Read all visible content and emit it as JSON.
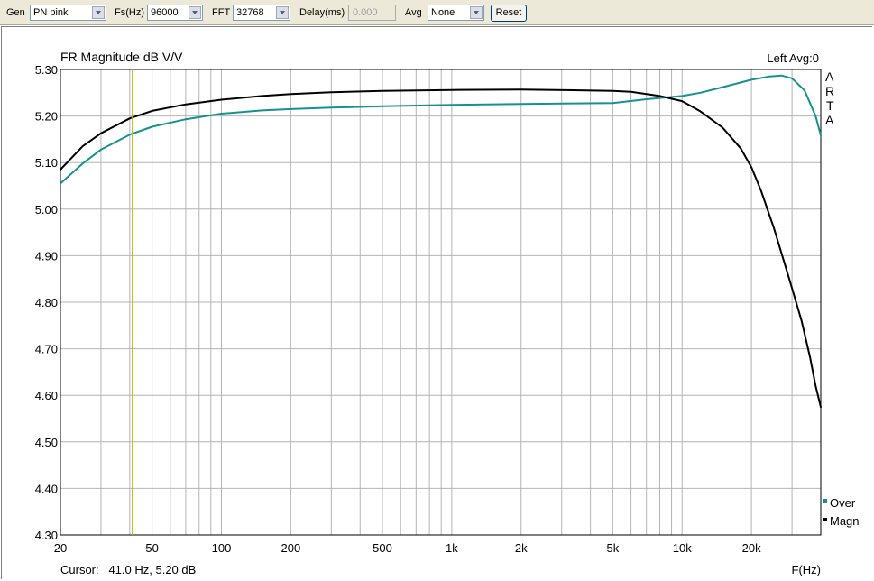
{
  "toolbar": {
    "gen_label": "Gen",
    "gen_value": "PN pink",
    "fs_label": "Fs(Hz)",
    "fs_value": "96000",
    "fft_label": "FFT",
    "fft_value": "32768",
    "delay_label": "Delay(ms)",
    "delay_value": "0.000",
    "avg_label": "Avg",
    "avg_value": "None",
    "reset_label": "Reset"
  },
  "plot": {
    "title": "FR Magnitude dB V/V",
    "status": "Left  Avg:0",
    "brand_letters": [
      "A",
      "R",
      "T",
      "A"
    ],
    "cursor_text": "Cursor:   41.0 Hz, 5.20 dB",
    "x_axis_label": "F(Hz)"
  },
  "colors": {
    "background": "#ffffff",
    "grid": "#b4b4b4",
    "over": "#17918f",
    "magn": "#000000",
    "cursor": "#c8b400"
  },
  "chart_data": {
    "type": "line",
    "title": "FR Magnitude dB V/V",
    "xlabel": "F(Hz)",
    "ylabel": "",
    "x_scale": "log",
    "xlim": [
      20,
      40000
    ],
    "ylim": [
      4.3,
      5.3
    ],
    "x_tick_labels": [
      {
        "value": 20,
        "label": "20"
      },
      {
        "value": 50,
        "label": "50"
      },
      {
        "value": 100,
        "label": "100"
      },
      {
        "value": 200,
        "label": "200"
      },
      {
        "value": 500,
        "label": "500"
      },
      {
        "value": 1000,
        "label": "1k"
      },
      {
        "value": 2000,
        "label": "2k"
      },
      {
        "value": 5000,
        "label": "5k"
      },
      {
        "value": 10000,
        "label": "10k"
      },
      {
        "value": 20000,
        "label": "20k"
      }
    ],
    "y_ticks": [
      4.3,
      4.4,
      4.5,
      4.6,
      4.7,
      4.8,
      4.9,
      5.0,
      5.1,
      5.2,
      5.3
    ],
    "y_tick_labels": [
      "4.30",
      "4.40",
      "4.50",
      "4.60",
      "4.70",
      "4.80",
      "4.90",
      "5.00",
      "5.10",
      "5.20",
      "5.30"
    ],
    "grid": true,
    "legend_position": "bottom-right",
    "cursor_x": 41.0,
    "series": [
      {
        "name": "Over",
        "color": "#17918f",
        "x": [
          20,
          25,
          30,
          40,
          50,
          70,
          100,
          150,
          200,
          300,
          500,
          1000,
          2000,
          5000,
          7000,
          10000,
          12000,
          15000,
          20000,
          24000,
          27000,
          30000,
          34000,
          38000,
          40000
        ],
        "y": [
          5.055,
          5.098,
          5.128,
          5.16,
          5.177,
          5.193,
          5.205,
          5.212,
          5.215,
          5.218,
          5.221,
          5.224,
          5.226,
          5.228,
          5.236,
          5.243,
          5.25,
          5.262,
          5.278,
          5.285,
          5.287,
          5.281,
          5.255,
          5.2,
          5.158
        ]
      },
      {
        "name": "Magn",
        "color": "#000000",
        "x": [
          20,
          25,
          30,
          40,
          50,
          70,
          100,
          150,
          200,
          300,
          500,
          1000,
          2000,
          5000,
          6000,
          8000,
          10000,
          12000,
          15000,
          18000,
          20000,
          22000,
          25000,
          28000,
          30000,
          33000,
          36000,
          38000,
          40000
        ],
        "y": [
          5.085,
          5.135,
          5.163,
          5.195,
          5.211,
          5.225,
          5.235,
          5.243,
          5.247,
          5.251,
          5.254,
          5.256,
          5.257,
          5.254,
          5.252,
          5.243,
          5.232,
          5.21,
          5.175,
          5.13,
          5.09,
          5.04,
          4.96,
          4.88,
          4.83,
          4.76,
          4.68,
          4.62,
          4.575
        ]
      }
    ]
  }
}
